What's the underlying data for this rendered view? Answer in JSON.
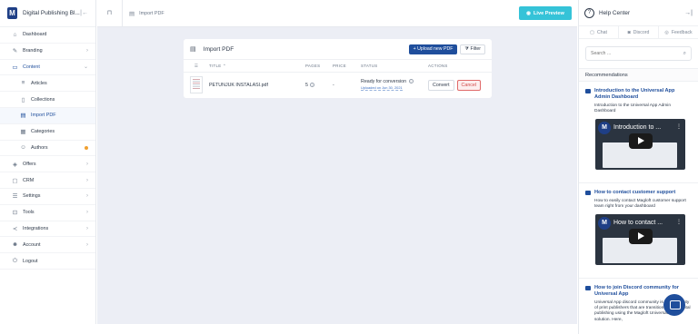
{
  "app": {
    "brand_name": "Digital Publishing Bl..."
  },
  "sidebar": {
    "items": [
      {
        "label": "Dashboard",
        "icon": "home-icon"
      },
      {
        "label": "Branding",
        "icon": "brush-icon"
      },
      {
        "label": "Content",
        "icon": "folder-icon"
      },
      {
        "label": "Articles",
        "icon": "list-icon"
      },
      {
        "label": "Collections",
        "icon": "book-icon"
      },
      {
        "label": "Import PDF",
        "icon": "file-icon"
      },
      {
        "label": "Categories",
        "icon": "grid-icon"
      },
      {
        "label": "Authors",
        "icon": "users-icon"
      },
      {
        "label": "Offers",
        "icon": "tag-icon"
      },
      {
        "label": "CRM",
        "icon": "chat-icon"
      },
      {
        "label": "Settings",
        "icon": "sliders-icon"
      },
      {
        "label": "Tools",
        "icon": "toolbox-icon"
      },
      {
        "label": "Integrations",
        "icon": "share-icon"
      },
      {
        "label": "Account",
        "icon": "user-icon"
      },
      {
        "label": "Logout",
        "icon": "logout-icon"
      }
    ]
  },
  "topbar": {
    "breadcrumb": "Import PDF",
    "live_preview_label": "Live Preview"
  },
  "import_card": {
    "title": "Import PDF",
    "upload_label": "Upload new PDF",
    "filter_label": "Filter",
    "columns": {
      "title": "TITLE",
      "pages": "PAGES",
      "price": "PRICE",
      "status": "STATUS",
      "actions": "ACTIONS"
    },
    "rows": [
      {
        "title": "PETUNJUK INSTALASI.pdf",
        "pages": "5",
        "price": "-",
        "status": "Ready for conversion",
        "uploaded": "Uploaded on Jun 30, 2021",
        "convert_label": "Convert",
        "cancel_label": "Cancel"
      }
    ]
  },
  "help": {
    "title": "Help Center",
    "tabs": [
      "Chat",
      "Discord",
      "Feedback"
    ],
    "search_placeholder": "Search ...",
    "recommendations_label": "Recommendations",
    "articles": [
      {
        "title": "Introduction to the Universal App Admin Dashboard",
        "desc": "Introduction to the Universal App Admin Dashboard",
        "video_title": "Introduction to ..."
      },
      {
        "title": "How to contact customer support",
        "desc": "How to easily contact Magloft customer support team right from your dashboard",
        "video_title": "How to contact ..."
      },
      {
        "title": "How to join Discord community for Universal App",
        "desc": "Universal App discord community is a community of print publishers that are transitioning into digital publishing using the Magloft Universal App solution. Here,"
      }
    ]
  },
  "colors": {
    "accent": "#1f4e9c",
    "live_preview": "#35c3d8",
    "cancel": "#d04848",
    "background": "#eceef5"
  }
}
